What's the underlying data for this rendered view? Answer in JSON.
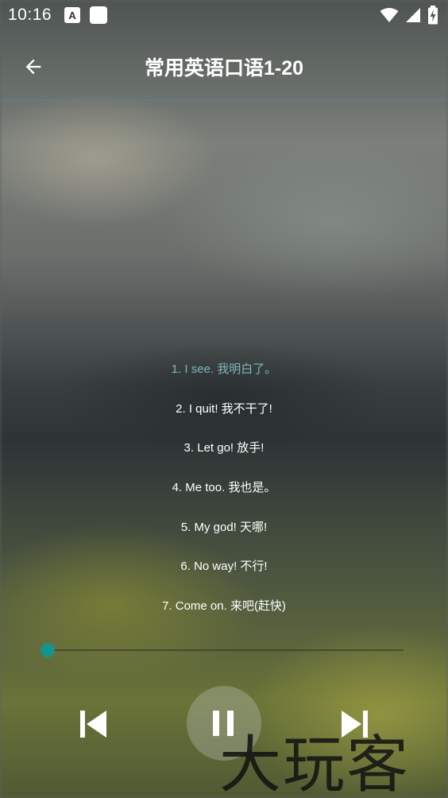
{
  "status_bar": {
    "time": "10:16",
    "notification_icons": [
      "a-badge-icon",
      "blank-square-icon"
    ],
    "notification_letter": "A",
    "right_icons": [
      "wifi-icon",
      "cellular-signal-icon",
      "battery-charging-icon"
    ]
  },
  "app_bar": {
    "back_icon": "arrow-left-icon",
    "title": "常用英语口语1-20"
  },
  "lyrics": [
    "1. I see. 我明白了。",
    "2. I quit! 我不干了!",
    "3. Let go! 放手!",
    "4. Me too. 我也是。",
    "5. My god! 天哪!",
    "6. No way! 不行!",
    "7. Come on. 来吧(赶快)"
  ],
  "active_lyric_index": 0,
  "player": {
    "progress_fraction": 0.0,
    "prev_icon": "skip-previous-icon",
    "play_pause_icon": "pause-icon",
    "next_icon": "skip-next-icon"
  },
  "watermark": {
    "text": "大玩客"
  },
  "colors": {
    "active_lyric": "#7fb7b8",
    "seek_thumb": "#16948c",
    "appbar_divider": "#5a82c8"
  }
}
